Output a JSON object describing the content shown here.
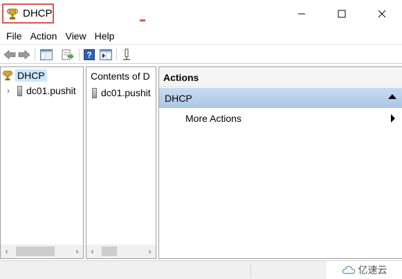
{
  "window": {
    "title": "DHCP",
    "icon": "trophy-dhcp-icon",
    "controls": [
      "minimize-icon",
      "maximize-icon",
      "close-icon"
    ]
  },
  "menu": {
    "items": [
      "File",
      "Action",
      "View",
      "Help"
    ]
  },
  "toolbar": {
    "buttons": [
      "back-arrow-icon",
      "forward-arrow-icon",
      "show-hide-console-tree-icon",
      "export-list-icon",
      "help-icon",
      "show-hide-action-pane-icon",
      "bookmark-icon"
    ]
  },
  "tree": {
    "root_label": "DHCP",
    "child_label": "dc01.pushit"
  },
  "contents": {
    "header": "Contents of D",
    "item_label": "dc01.pushit"
  },
  "actions": {
    "title": "Actions",
    "section": "DHCP",
    "more_label": "More Actions"
  },
  "watermark": {
    "text": "亿速云"
  },
  "colors": {
    "selection": "#cce8ff",
    "actions_section": "#aac6e4",
    "title_highlight": "#d9534f"
  }
}
